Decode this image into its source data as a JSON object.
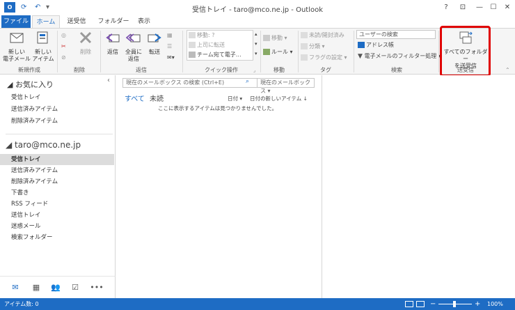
{
  "titlebar": {
    "title": "受信トレイ - taro@mco.ne.jp - Outlook",
    "help": "?",
    "restore": "⊡",
    "minimize": "—",
    "maximize": "☐",
    "close": "✕"
  },
  "tabs": [
    "ファイル",
    "ホーム",
    "送受信",
    "フォルダー",
    "表示"
  ],
  "ribbon": {
    "new": {
      "new_mail": [
        "新しい",
        "電子メール"
      ],
      "new_items": [
        "新しい",
        "アイテム"
      ],
      "group": "新規作成"
    },
    "delete": {
      "delete": "削除",
      "group": "削除"
    },
    "respond": {
      "reply": "返信",
      "reply_all": [
        "全員に",
        "返信"
      ],
      "forward": "転送",
      "group": "返信"
    },
    "quick_steps": {
      "items": [
        "移動: ?",
        "上司に転送",
        "チーム宛て電子…"
      ],
      "group": "クイック操作"
    },
    "move": {
      "move": "移動",
      "rules": "ルール",
      "group": "移動"
    },
    "tags": {
      "unread_read": "未読/開封済み",
      "categorize": "分類",
      "follow_up": "フラグの設定",
      "group": "タグ"
    },
    "find": {
      "search_people_placeholder": "ユーザーの検索",
      "address_book": "アドレス帳",
      "filter_email": "電子メールのフィルター処理",
      "group": "検索"
    },
    "send_receive": {
      "send_receive_all": [
        "すべてのフォルダー",
        "を送受信"
      ],
      "group": "送受信"
    }
  },
  "folder_pane": {
    "favorites_header": "お気に入り",
    "favorites": [
      "受信トレイ",
      "送信済みアイテム",
      "削除済みアイテム"
    ],
    "account": "taro@mco.ne.jp",
    "folders": [
      "受信トレイ",
      "送信済みアイテム",
      "削除済みアイテム",
      "下書き",
      "RSS フィード",
      "送信トレイ",
      "迷惑メール",
      "検索フォルダー"
    ],
    "collapse": "‹"
  },
  "list_pane": {
    "search_placeholder": "現在のメールボックス の検索 (Ctrl+E)",
    "scope": "現在のメールボックス",
    "filter_all": "すべて",
    "filter_unread": "未読",
    "sort_by": "日付",
    "sort_order": "日付の新しいアイテム",
    "empty_message": "ここに表示するアイテムは見つかりませんでした。"
  },
  "status": {
    "items": "アイテム数: 0",
    "zoom": "100%"
  },
  "colors": {
    "accent": "#1e6cc4",
    "highlight": "#e00000"
  }
}
